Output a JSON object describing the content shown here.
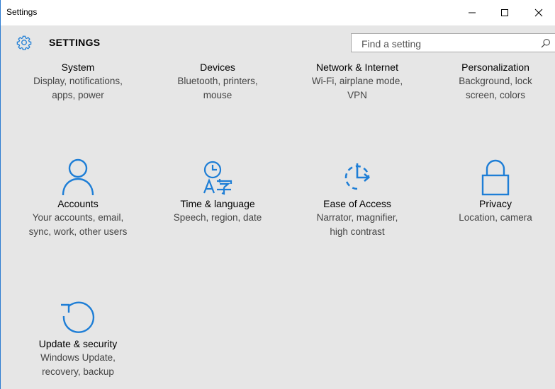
{
  "window": {
    "title": "Settings"
  },
  "header": {
    "title": "SETTINGS",
    "search_placeholder": "Find a setting"
  },
  "tiles": [
    {
      "name": "System",
      "desc_line1": "Display, notifications,",
      "desc_line2": "apps, power",
      "icon": "system-icon"
    },
    {
      "name": "Devices",
      "desc_line1": "Bluetooth, printers,",
      "desc_line2": "mouse",
      "icon": "devices-icon"
    },
    {
      "name": "Network & Internet",
      "desc_line1": "Wi-Fi, airplane mode,",
      "desc_line2": "VPN",
      "icon": "network-icon"
    },
    {
      "name": "Personalization",
      "desc_line1": "Background, lock",
      "desc_line2": "screen, colors",
      "icon": "personalization-icon"
    },
    {
      "name": "Accounts",
      "desc_line1": "Your accounts, email,",
      "desc_line2": "sync, work, other users",
      "icon": "person-icon"
    },
    {
      "name": "Time & language",
      "desc_line1": "Speech, region, date",
      "desc_line2": "",
      "icon": "time-language-icon"
    },
    {
      "name": "Ease of Access",
      "desc_line1": "Narrator, magnifier,",
      "desc_line2": "high contrast",
      "icon": "ease-of-access-icon"
    },
    {
      "name": "Privacy",
      "desc_line1": "Location, camera",
      "desc_line2": "",
      "icon": "lock-icon"
    },
    {
      "name": "Update & security",
      "desc_line1": "Windows Update,",
      "desc_line2": "recovery, backup",
      "icon": "update-icon"
    }
  ],
  "colors": {
    "accent": "#1e7ed6",
    "background": "#e6e6e6"
  }
}
